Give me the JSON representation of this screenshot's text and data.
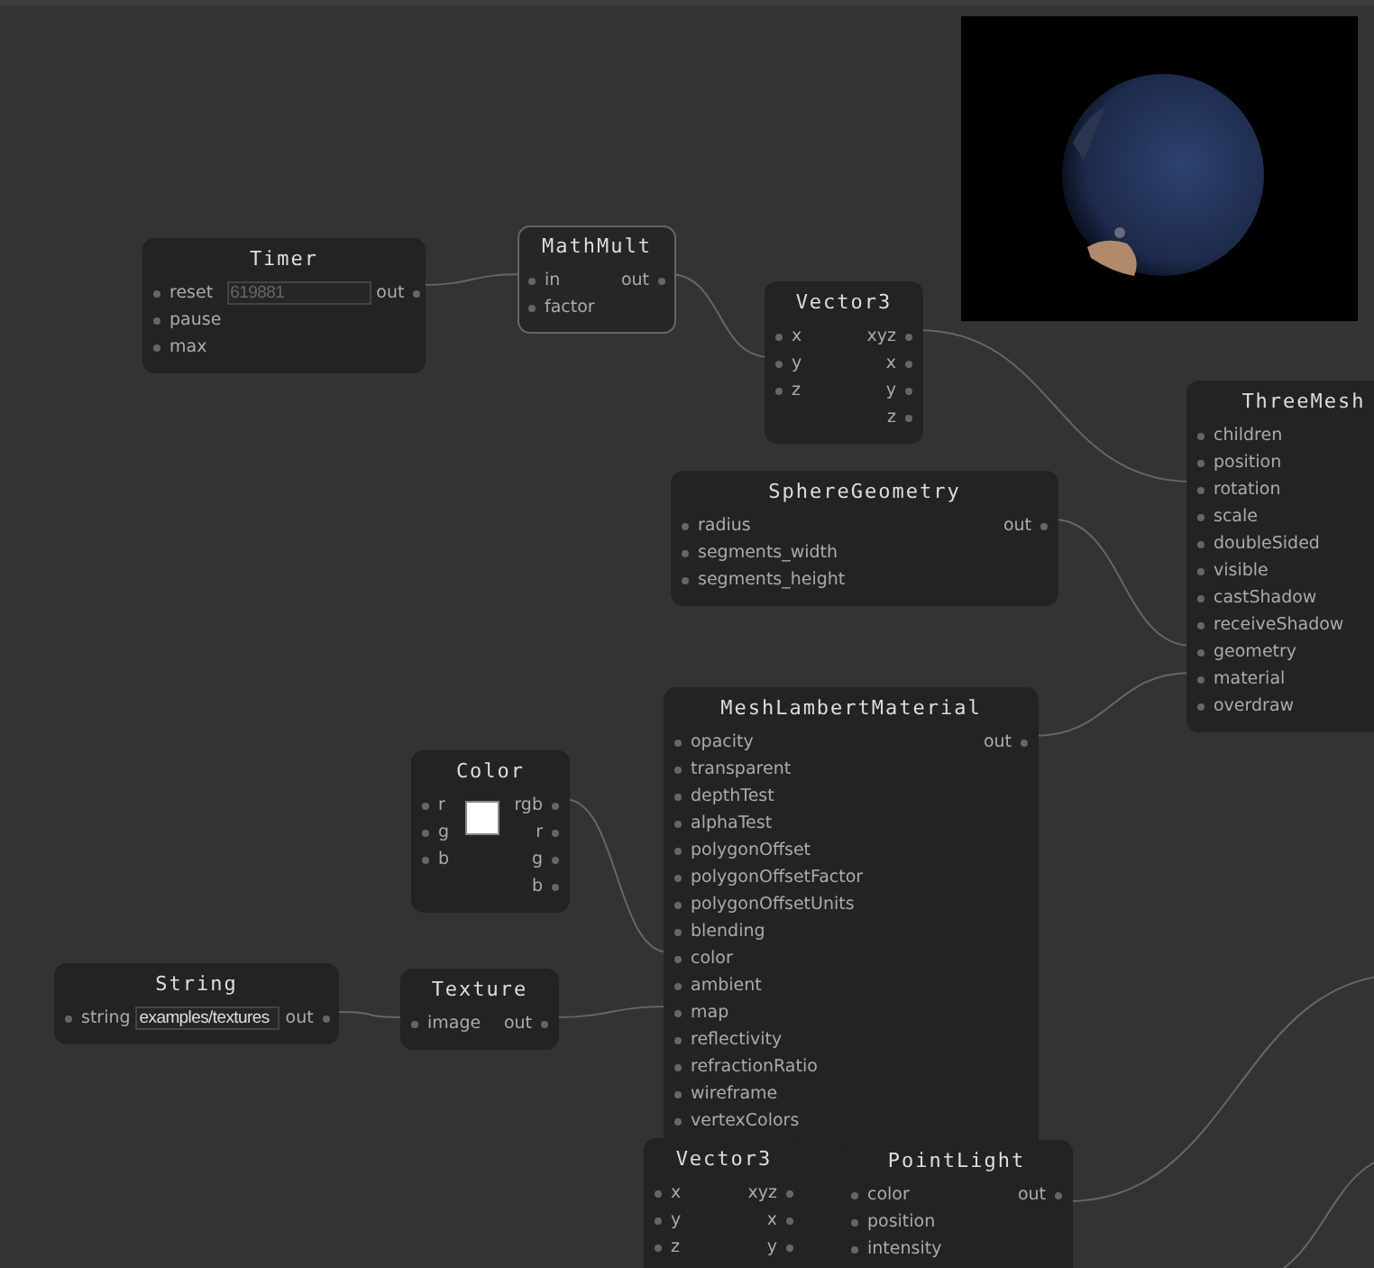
{
  "nodes": [
    {
      "title": "Timer",
      "selected": false,
      "inputs": [
        "reset",
        "pause",
        "max"
      ],
      "field": {
        "placeholder": "619881"
      },
      "outputs": [
        "out"
      ]
    },
    {
      "title": "MathMult",
      "selected": true,
      "inputs": [
        "in",
        "factor"
      ],
      "outputs": [
        "out"
      ]
    },
    {
      "title": "Vector3",
      "selected": false,
      "inputs": [
        "x",
        "y",
        "z"
      ],
      "outputs": [
        "xyz",
        "x",
        "y",
        "z"
      ]
    },
    {
      "title": "ThreeMesh",
      "selected": false,
      "inputs": [
        "children",
        "position",
        "rotation",
        "scale",
        "doubleSided",
        "visible",
        "castShadow",
        "receiveShadow",
        "geometry",
        "material",
        "overdraw"
      ]
    },
    {
      "title": "SphereGeometry",
      "selected": false,
      "inputs": [
        "radius",
        "segments_width",
        "segments_height"
      ],
      "outputs": [
        "out"
      ]
    },
    {
      "title": "MeshLambertMaterial",
      "selected": false,
      "inputs": [
        "opacity",
        "transparent",
        "depthTest",
        "alphaTest",
        "polygonOffset",
        "polygonOffsetFactor",
        "polygonOffsetUnits",
        "blending",
        "color",
        "ambient",
        "map",
        "reflectivity",
        "refractionRatio",
        "wireframe",
        "vertexColors"
      ],
      "outputs": [
        "out"
      ]
    },
    {
      "title": "Color",
      "selected": false,
      "inputs": [
        "r",
        "g",
        "b"
      ],
      "color": "#ffffff",
      "outputs": [
        "rgb",
        "r",
        "g",
        "b"
      ]
    },
    {
      "title": "String",
      "selected": false,
      "inputs": [
        "string"
      ],
      "field": {
        "value": "examples/textures"
      },
      "outputs": [
        "out"
      ]
    },
    {
      "title": "Texture",
      "selected": false,
      "inputs": [
        "image"
      ],
      "outputs": [
        "out"
      ]
    },
    {
      "title": "Vector3",
      "selected": false,
      "inputs": [
        "x",
        "y",
        "z"
      ],
      "outputs": [
        "xyz",
        "x",
        "y"
      ]
    },
    {
      "title": "PointLight",
      "selected": false,
      "inputs": [
        "color",
        "position",
        "intensity"
      ],
      "outputs": [
        "out"
      ]
    }
  ]
}
